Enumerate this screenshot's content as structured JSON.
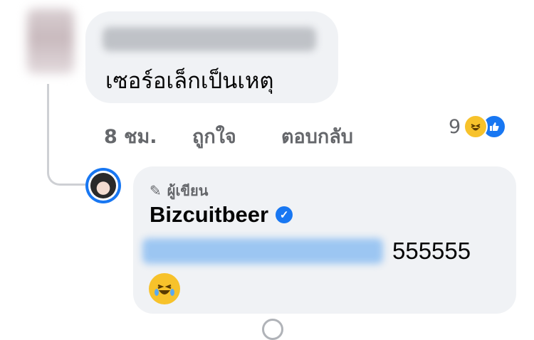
{
  "comment": {
    "author_name_blurred": true,
    "text": "เซอร์อเล็กเป็นเหตุ",
    "time": "8 ชม.",
    "like_label": "ถูกใจ",
    "reply_label": "ตอบกลับ",
    "reaction_count": "9",
    "reactions": [
      "haha-icon",
      "like-icon"
    ]
  },
  "reply": {
    "badge_label": "ผู้เขียน",
    "author_name": "Bizcuitbeer",
    "verified": true,
    "mention_blurred": true,
    "text": "555555",
    "emoji": "laughing-crying-emoji"
  },
  "colors": {
    "bubble": "#f0f2f5",
    "meta_text": "#65676b",
    "accent": "#1877f2",
    "haha": "#f7c22b"
  }
}
